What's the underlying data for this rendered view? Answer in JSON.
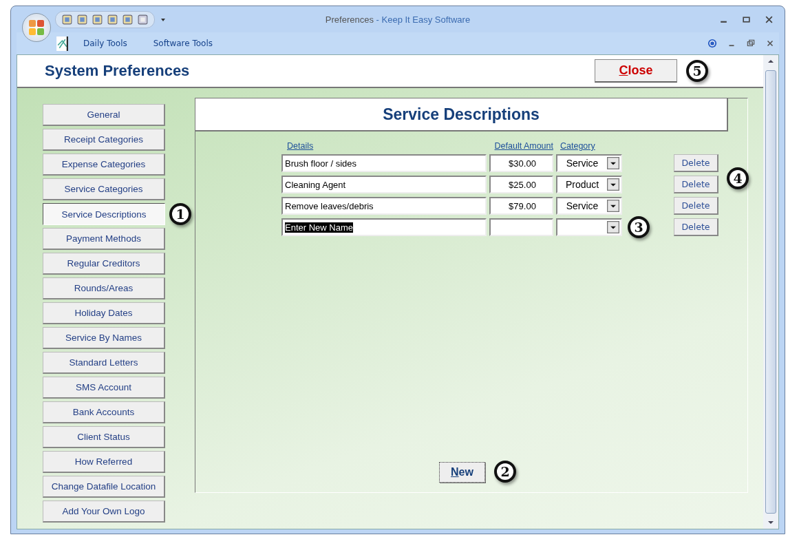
{
  "window": {
    "title": "Preferences",
    "subtitle": "- Keep It Easy Software"
  },
  "menu": [
    {
      "label": "Daily Tools"
    },
    {
      "label": "Software Tools"
    }
  ],
  "header": {
    "title": "System Preferences",
    "close": "Close",
    "callout": "5"
  },
  "sidebar": {
    "callout": "1",
    "items": [
      {
        "label": "General",
        "selected": false
      },
      {
        "label": "Receipt Categories",
        "selected": false
      },
      {
        "label": "Expense Categories",
        "selected": false
      },
      {
        "label": "Service Categories",
        "selected": false
      },
      {
        "label": "Service Descriptions",
        "selected": true
      },
      {
        "label": "Payment Methods",
        "selected": false
      },
      {
        "label": "Regular Creditors",
        "selected": false
      },
      {
        "label": "Rounds/Areas",
        "selected": false
      },
      {
        "label": "Holiday Dates",
        "selected": false
      },
      {
        "label": "Service By Names",
        "selected": false
      },
      {
        "label": "Standard Letters",
        "selected": false
      },
      {
        "label": "SMS Account",
        "selected": false
      },
      {
        "label": "Bank Accounts",
        "selected": false
      },
      {
        "label": "Client Status",
        "selected": false
      },
      {
        "label": "How Referred",
        "selected": false
      },
      {
        "label": "Change Datafile Location",
        "selected": false
      },
      {
        "label": "Add Your Own Logo",
        "selected": false
      }
    ]
  },
  "panel": {
    "title": "Service Descriptions",
    "columns": [
      "Details",
      "Default Amount",
      "Category"
    ],
    "rows": [
      {
        "details": "Brush floor / sides",
        "amount": "$30.00",
        "category": "Service",
        "highlighted": false,
        "delete": "Delete"
      },
      {
        "details": "Cleaning Agent",
        "amount": "$25.00",
        "category": "Product",
        "highlighted": false,
        "delete": "Delete"
      },
      {
        "details": "Remove leaves/debris",
        "amount": "$79.00",
        "category": "Service",
        "highlighted": false,
        "delete": "Delete"
      },
      {
        "details": "Enter New Name",
        "highlighted": true,
        "delete": "Delete"
      }
    ],
    "callout_new_row": "3",
    "callout_delete": "4",
    "new_button": "New",
    "callout_new": "2"
  }
}
